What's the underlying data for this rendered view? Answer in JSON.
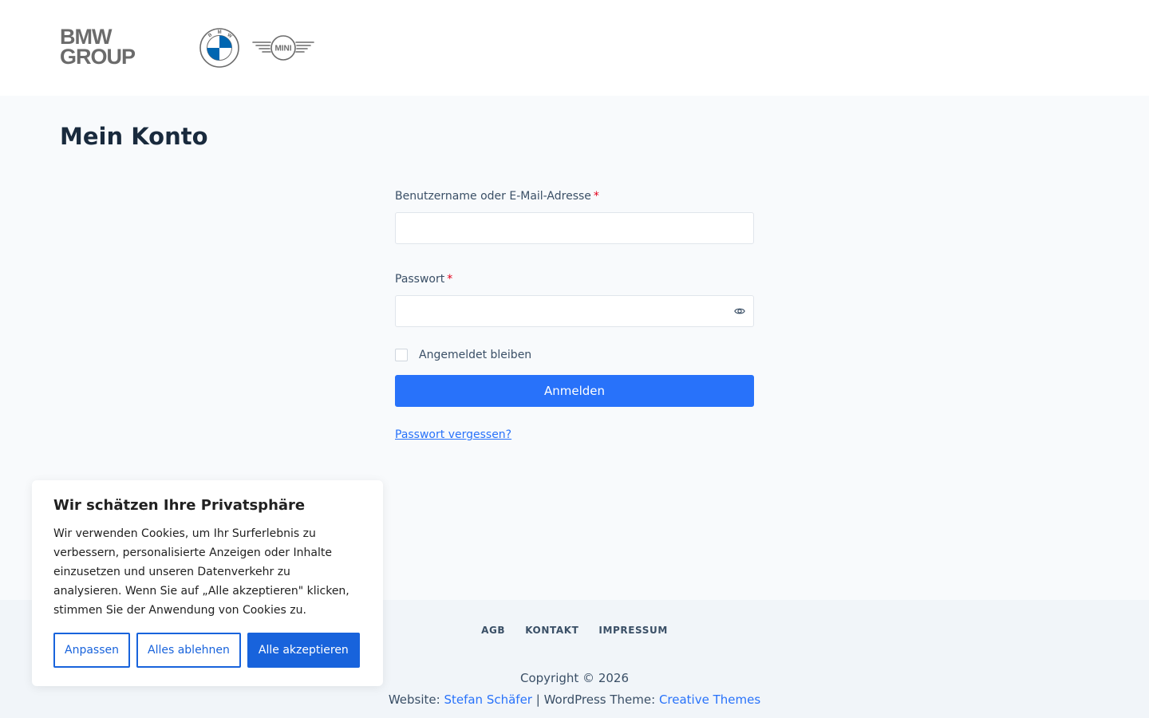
{
  "header": {
    "brand_line1": "BMW",
    "brand_line2": "GROUP",
    "roundel_letters": "BMW",
    "mini_text": "MINI",
    "icons": [
      "bmw-roundel-icon",
      "mini-wings-icon"
    ],
    "roundel_colors": {
      "blue": "#0066b1",
      "ring": "#6b6b6b"
    }
  },
  "page": {
    "title": "Mein Konto"
  },
  "login_form": {
    "username_label": "Benutzername oder E-Mail-Adresse",
    "username_value": "",
    "password_label": "Passwort",
    "password_value": "",
    "required_mark": "*",
    "remember_label": "Angemeldet bleiben",
    "remember_checked": false,
    "submit_label": "Anmelden",
    "lost_password_label": "Passwort vergessen?"
  },
  "footer": {
    "nav": [
      "AGB",
      "KONTAKT",
      "IMPRESSUM"
    ],
    "copyright": "Copyright © 2026",
    "credits_prefix": "Website: ",
    "credits_author": "Stefan Schäfer",
    "credits_middle": " | WordPress Theme: ",
    "credits_theme": "Creative Themes"
  },
  "cookie_banner": {
    "title": "Wir schätzen Ihre Privatsphäre",
    "text": "Wir verwenden Cookies, um Ihr Surferlebnis zu verbessern, personalisierte Anzeigen oder Inhalte einzusetzen und unseren Datenverkehr zu analysieren. Wenn Sie auf „Alle akzeptieren\" klicken, stimmen Sie der Anwendung von Cookies zu.",
    "customize_label": "Anpassen",
    "reject_label": "Alles ablehnen",
    "accept_label": "Alle akzeptieren"
  },
  "colors": {
    "accent": "#2872fa",
    "cookie_accent": "#1863dc",
    "required": "#e3001b",
    "title": "#192a3d"
  }
}
